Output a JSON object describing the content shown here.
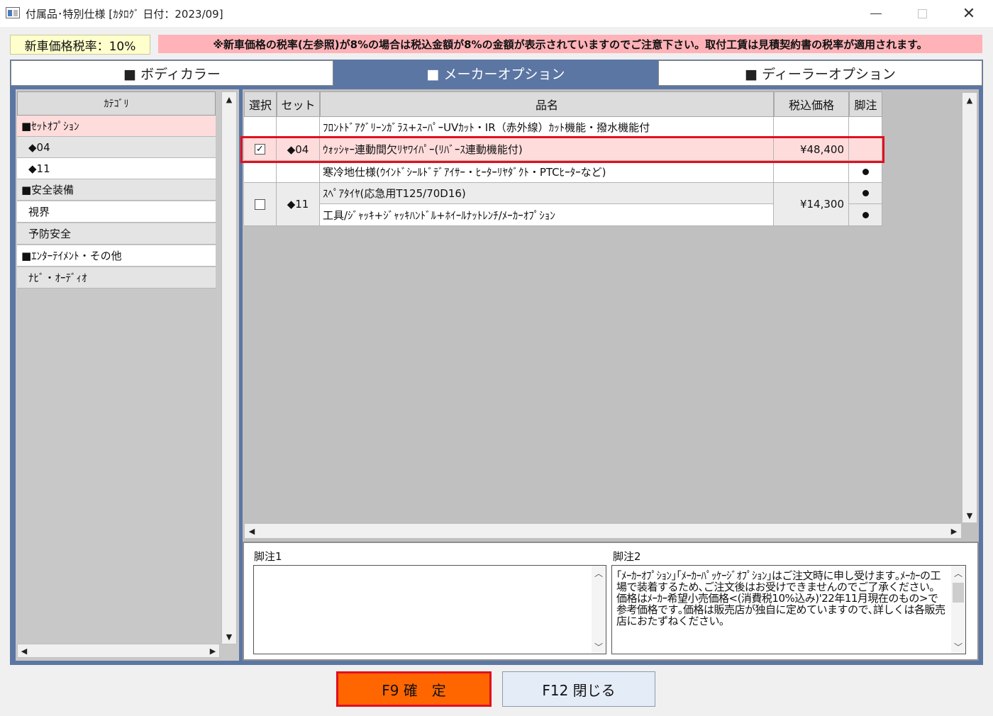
{
  "window": {
    "title": "付属品･特別仕様 [ｶﾀﾛｸﾞ 日付：2023/09]",
    "min": "—",
    "max": "□",
    "close": "✕"
  },
  "tax": {
    "label": "新車価格税率：10%",
    "notice": "※新車価格の税率(左参照)が8%の場合は税込金額が8%の金額が表示されていますのでご注意下さい。取付工賃は見積契約書の税率が適用されます。"
  },
  "tabs": [
    {
      "label": "■ ボディカラー"
    },
    {
      "label": "■ メーカーオプション"
    },
    {
      "label": "■ ディーラーオプション"
    }
  ],
  "categories": {
    "header": "ｶﾃｺﾞﾘ",
    "items": [
      {
        "label": "■ｾｯﾄｵﾌﾟｼｮﾝ"
      },
      {
        "label": "◆04"
      },
      {
        "label": "◆11"
      },
      {
        "label": "■安全装備"
      },
      {
        "label": "視界"
      },
      {
        "label": "予防安全"
      },
      {
        "label": "■ｴﾝﾀｰﾃｲﾒﾝﾄ・その他"
      },
      {
        "label": "ﾅﾋﾞ・ｵｰﾃﾞｨｵ"
      }
    ]
  },
  "grid": {
    "headers": {
      "select": "選択",
      "set": "セット",
      "name": "品名",
      "price": "税込価格",
      "note": "脚注"
    },
    "rows": [
      {
        "name": "ﾌﾛﾝﾄﾄﾞｱｸﾞﾘｰﾝｶﾞﾗｽ+ｽｰﾊﾟｰUVｶｯﾄ・IR（赤外線）ｶｯﾄ機能・撥水機能付"
      },
      {
        "set": "◆04",
        "name": "ｳｫｯｼｬｰ連動間欠ﾘﾔﾜｲﾊﾟｰ(ﾘﾊﾞｰｽ連動機能付)",
        "price": "¥48,400",
        "checked": "✓"
      },
      {
        "name": "寒冷地仕様(ｳｲﾝﾄﾞｼｰﾙﾄﾞﾃﾞｱｲｻｰ・ﾋｰﾀｰﾘﾔﾀﾞｸﾄ・PTCﾋｰﾀｰなど)"
      },
      {
        "set": "◆11",
        "name": "ｽﾍﾟｱﾀｲﾔ(応急用T125/70D16)",
        "price": "¥14,300"
      },
      {
        "name": "工具/ｼﾞｬｯｷ+ｼﾞｬｯｷﾊﾝﾄﾞﾙ+ﾎｲｰﾙﾅｯﾄﾚﾝﾁ/ﾒｰｶｰｵﾌﾟｼｮﾝ"
      }
    ]
  },
  "footnotes": {
    "label1": "脚注1",
    "label2": "脚注2",
    "text1": "",
    "text2": "｢ﾒｰｶｰｵﾌﾟｼｮﾝ｣｢ﾒｰｶｰﾊﾟｯｹｰｼﾞｵﾌﾟｼｮﾝ｣はご注文時に申し受けます｡ﾒｰｶｰの工場で装着するため､ご注文後はお受けできませんのでご了承ください｡\n価格はﾒｰｶｰ希望小売価格<(消費税10%込み)'22年11月現在のもの>で参考価格です｡価格は販売店が独自に定めていますので､詳しくは各販売店におたずねください｡"
  },
  "buttons": {
    "confirm": "F9 確　定",
    "close": "F12 閉じる"
  },
  "colors": {
    "accent_tab": "#5b76a3",
    "selected_row": "#ffdcdc",
    "highlight_box": "#e01020",
    "confirm_button": "#ff6600"
  }
}
